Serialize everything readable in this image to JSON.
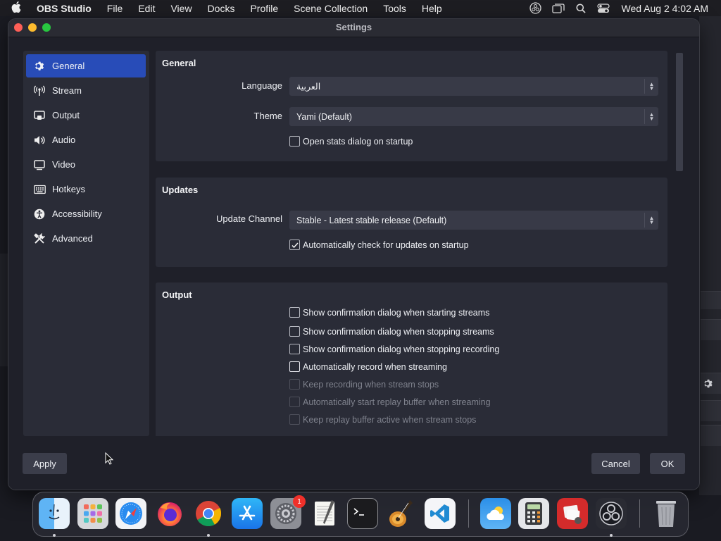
{
  "menubar": {
    "app_name": "OBS Studio",
    "menus": [
      "File",
      "Edit",
      "View",
      "Docks",
      "Profile",
      "Scene Collection",
      "Tools",
      "Help"
    ],
    "clock": "Wed Aug 2  4:02 AM",
    "status_icons": [
      "obs-icon",
      "window-switcher-icon",
      "spotlight-search-icon",
      "control-center-icon"
    ]
  },
  "window": {
    "title": "Settings"
  },
  "sidebar": {
    "items": [
      {
        "label": "General",
        "icon": "gear-icon",
        "active": true
      },
      {
        "label": "Stream",
        "icon": "antenna-icon",
        "active": false
      },
      {
        "label": "Output",
        "icon": "output-icon",
        "active": false
      },
      {
        "label": "Audio",
        "icon": "speaker-icon",
        "active": false
      },
      {
        "label": "Video",
        "icon": "monitor-icon",
        "active": false
      },
      {
        "label": "Hotkeys",
        "icon": "keyboard-icon",
        "active": false
      },
      {
        "label": "Accessibility",
        "icon": "accessibility-icon",
        "active": false
      },
      {
        "label": "Advanced",
        "icon": "wrench-screwdriver-icon",
        "active": false
      }
    ]
  },
  "general": {
    "title": "General",
    "language_label": "Language",
    "language_value": "العربية",
    "theme_label": "Theme",
    "theme_value": "Yami (Default)",
    "open_stats_label": "Open stats dialog on startup",
    "open_stats_checked": false
  },
  "updates": {
    "title": "Updates",
    "channel_label": "Update Channel",
    "channel_value": "Stable - Latest stable release (Default)",
    "auto_check_label": "Automatically check for updates on startup",
    "auto_check_checked": true
  },
  "output": {
    "title": "Output",
    "options": [
      {
        "label": "Show confirmation dialog when starting streams",
        "checked": false,
        "enabled": true
      },
      {
        "label": "Show confirmation dialog when stopping streams",
        "checked": false,
        "enabled": true
      },
      {
        "label": "Show confirmation dialog when stopping recording",
        "checked": false,
        "enabled": true
      },
      {
        "label": "Automatically record when streaming",
        "checked": false,
        "enabled": true
      },
      {
        "label": "Keep recording when stream stops",
        "checked": false,
        "enabled": false
      },
      {
        "label": "Automatically start replay buffer when streaming",
        "checked": false,
        "enabled": false
      },
      {
        "label": "Keep replay buffer active when stream stops",
        "checked": false,
        "enabled": false
      }
    ]
  },
  "buttons": {
    "apply": "Apply",
    "cancel": "Cancel",
    "ok": "OK"
  },
  "dock": {
    "apps": [
      "Finder",
      "Launchpad",
      "Safari",
      "Firefox",
      "Chrome",
      "App Store",
      "System Settings",
      "TextEdit",
      "Terminal",
      "GarageBand",
      "Visual Studio Code",
      "Weather",
      "Calculator",
      "Photo Booth",
      "OBS Studio",
      "Trash"
    ],
    "settings_badge": "1"
  },
  "colors": {
    "accent": "#284cb8",
    "panel": "#2a2c37",
    "window_bg": "#1f2029"
  }
}
